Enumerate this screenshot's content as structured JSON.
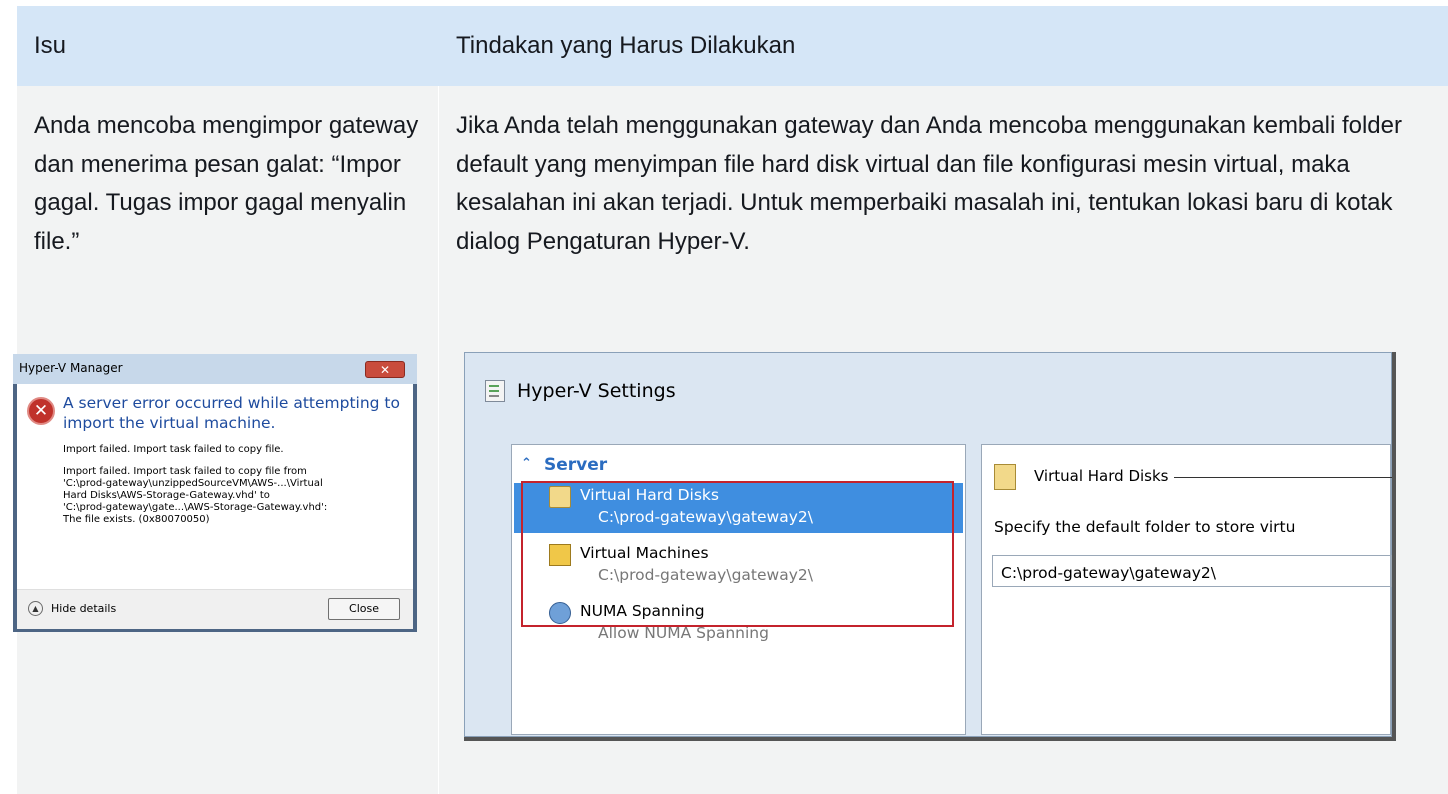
{
  "table": {
    "header": {
      "col1": "Isu",
      "col2": "Tindakan yang Harus Dilakukan"
    },
    "row": {
      "issue": "Anda mencoba mengimpor gateway dan menerima pesan galat: “Impor gagal. Tugas impor gagal menyalin file.”",
      "action": "Jika Anda telah menggunakan gateway dan Anda mencoba menggunakan kembali folder default yang menyimpan file hard disk virtual dan file konfigurasi mesin virtual, maka kesalahan ini akan terjadi. Untuk memperbaiki masalah ini, tentukan lokasi baru di kotak dialog Pengaturan Hyper-V."
    }
  },
  "error_dialog": {
    "title": "Hyper-V Manager",
    "close_glyph": "✕",
    "heading": "A server error occurred while attempting to import the virtual machine.",
    "message_short": "Import failed. Import task failed to copy file.",
    "message_detail": "Import failed. Import task failed to copy file from\n'C:\\prod-gateway\\unzippedSourceVM\\AWS-...\\Virtual\nHard Disks\\AWS-Storage-Gateway.vhd' to\n'C:\\prod-gateway\\gate...\\AWS-Storage-Gateway.vhd':\nThe file exists. (0x80070050)",
    "hide_details_label": "Hide details",
    "close_button": "Close"
  },
  "settings_window": {
    "title": "Hyper-V Settings",
    "nav": {
      "section_label": "Server",
      "items": [
        {
          "title": "Virtual Hard Disks",
          "sub": "C:\\prod-gateway\\gateway2\\",
          "icon": "disk-icon",
          "selected": true
        },
        {
          "title": "Virtual Machines",
          "sub": "C:\\prod-gateway\\gateway2\\",
          "icon": "vm-folder-icon",
          "selected": false
        },
        {
          "title": "NUMA Spanning",
          "sub": "Allow NUMA Spanning",
          "icon": "numa-icon",
          "selected": false
        }
      ]
    },
    "detail": {
      "heading": "Virtual Hard Disks",
      "description": "Specify the default folder to store virtu",
      "path_value": "C:\\prod-gateway\\gateway2\\"
    },
    "highlight_color": "#c4232c"
  }
}
